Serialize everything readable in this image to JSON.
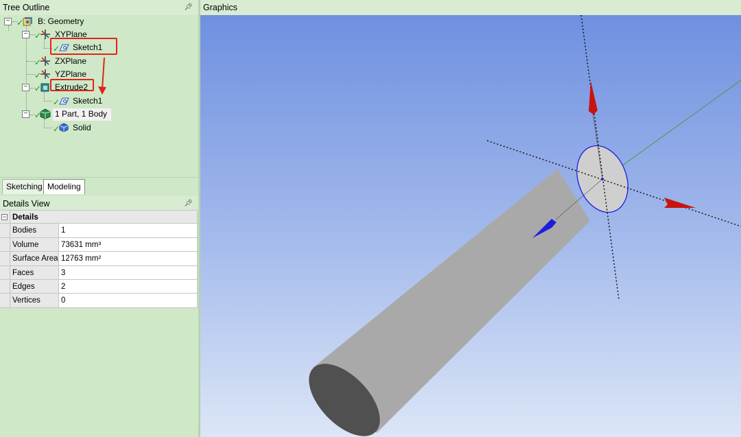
{
  "tree_outline": {
    "title": "Tree Outline",
    "nodes": {
      "geometry": "B: Geometry",
      "xyplane": "XYPlane",
      "sketch1_a": "Sketch1",
      "zxplane": "ZXPlane",
      "yzplane": "YZPlane",
      "extrude2": "Extrude2",
      "sketch1_b": "Sketch1",
      "parts": "1 Part, 1 Body",
      "solid": "Solid"
    }
  },
  "tabs": {
    "sketching": "Sketching",
    "modeling": "Modeling"
  },
  "details_view": {
    "title": "Details View",
    "group": "Details",
    "rows": [
      {
        "key": "Bodies",
        "value": "1"
      },
      {
        "key": "Volume",
        "value": "73631 mm³"
      },
      {
        "key": "Surface Area",
        "value": "12763 mm²"
      },
      {
        "key": "Faces",
        "value": "3"
      },
      {
        "key": "Edges",
        "value": "2"
      },
      {
        "key": "Vertices",
        "value": "0"
      }
    ]
  },
  "graphics": {
    "title": "Graphics"
  },
  "colors": {
    "panel_bg": "#cfe8c8",
    "highlight": "#e2231a",
    "viewport_top": "#6f90e0",
    "viewport_bottom": "#dce6f7"
  }
}
